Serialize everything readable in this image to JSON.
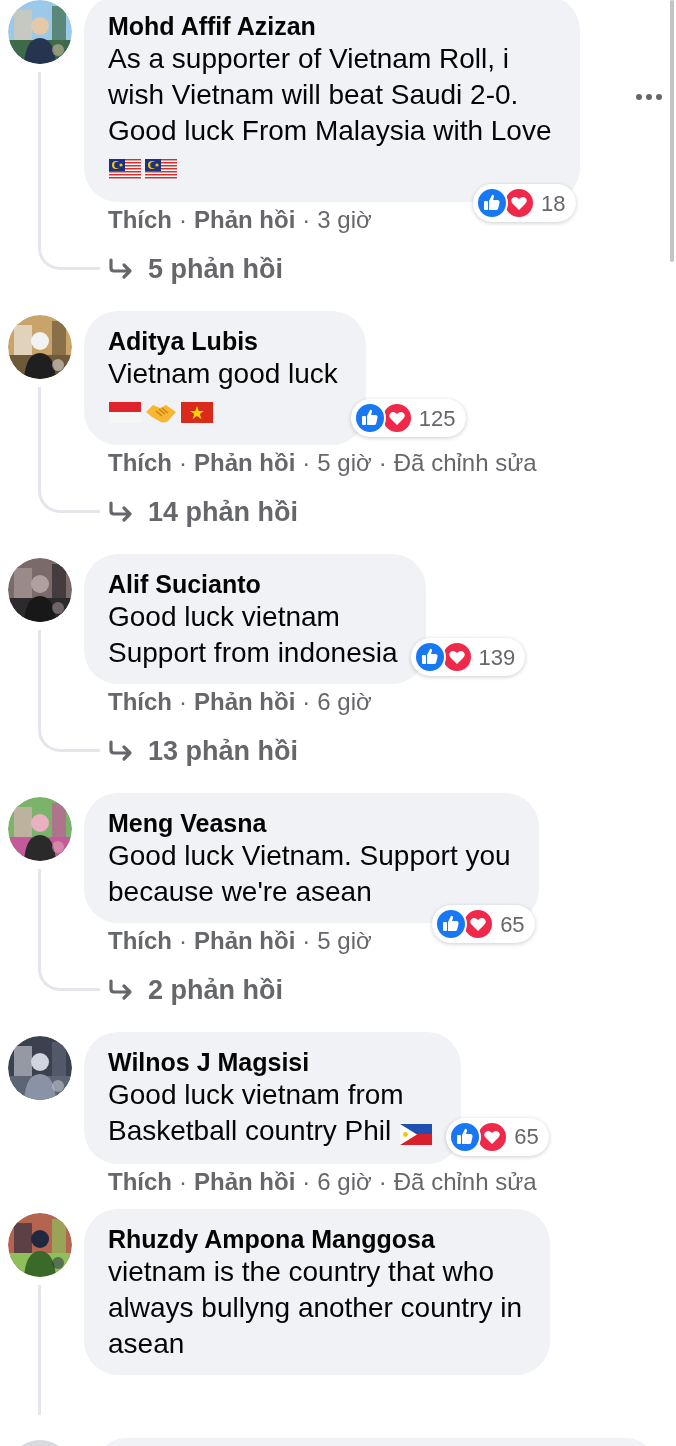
{
  "comments": [
    {
      "author": "Mohd Affif Azizan",
      "text": "As a supporter of Vietnam Roll, i\nwish Vietnam will beat Saudi 2-0.\nGood luck From Malaysia with Love",
      "emojis": [
        {
          "kind": "flag_malaysia"
        },
        {
          "kind": "flag_malaysia"
        }
      ],
      "reaction_count": "18",
      "meta": [
        {
          "kind": "link",
          "text": "Thích"
        },
        {
          "kind": "sep",
          "text": "·"
        },
        {
          "kind": "link",
          "text": "Phản hồi"
        },
        {
          "kind": "sep",
          "text": "·"
        },
        {
          "kind": "time",
          "text": "3 giờ"
        }
      ],
      "replies": "5 phản hồi",
      "thread": true,
      "more_menu": true
    },
    {
      "author": "Aditya Lubis",
      "text": "Vietnam good luck",
      "emojis": [
        {
          "kind": "flag_indonesia"
        },
        {
          "kind": "handshake"
        },
        {
          "kind": "flag_vietnam"
        }
      ],
      "reaction_count": "125",
      "meta": [
        {
          "kind": "link",
          "text": "Thích"
        },
        {
          "kind": "sep",
          "text": "·"
        },
        {
          "kind": "link",
          "text": "Phản hồi"
        },
        {
          "kind": "sep",
          "text": "·"
        },
        {
          "kind": "time",
          "text": "5 giờ"
        },
        {
          "kind": "sep",
          "text": "·"
        },
        {
          "kind": "edited",
          "text": "Đã chỉnh sửa"
        }
      ],
      "replies": "14 phản hồi",
      "thread": true,
      "more_menu": false
    },
    {
      "author": "Alif Sucianto",
      "text": "Good luck vietnam\nSupport from indonesia",
      "reaction_count": "139",
      "meta": [
        {
          "kind": "link",
          "text": "Thích"
        },
        {
          "kind": "sep",
          "text": "·"
        },
        {
          "kind": "link",
          "text": "Phản hồi"
        },
        {
          "kind": "sep",
          "text": "·"
        },
        {
          "kind": "time",
          "text": "6 giờ"
        }
      ],
      "replies": "13 phản hồi",
      "thread": true,
      "more_menu": false
    },
    {
      "author": "Meng Veasna",
      "text": "Good luck Vietnam. Support you\nbecause we're asean",
      "reaction_count": "65",
      "meta": [
        {
          "kind": "link",
          "text": "Thích"
        },
        {
          "kind": "sep",
          "text": "·"
        },
        {
          "kind": "link",
          "text": "Phản hồi"
        },
        {
          "kind": "sep",
          "text": "·"
        },
        {
          "kind": "time",
          "text": "5 giờ"
        }
      ],
      "replies": "2 phản hồi",
      "thread": true,
      "more_menu": false
    },
    {
      "author": "Wilnos J Magsisi",
      "text": "Good luck vietnam from\nBasketball country Phil",
      "inline_emoji": {
        "kind": "flag_philippines"
      },
      "reaction_count": "65",
      "meta": [
        {
          "kind": "link",
          "text": "Thích"
        },
        {
          "kind": "sep",
          "text": "·"
        },
        {
          "kind": "link",
          "text": "Phản hồi"
        },
        {
          "kind": "sep",
          "text": "·"
        },
        {
          "kind": "time",
          "text": "6 giờ"
        },
        {
          "kind": "sep",
          "text": "·"
        },
        {
          "kind": "edited",
          "text": "Đã chỉnh sửa"
        }
      ],
      "thread": false,
      "more_menu": false
    },
    {
      "author": "Rhuzdy Ampona Manggosa",
      "text": "vietnam is the country that who\nalways bullyng another country in\nasean",
      "thread": true,
      "more_menu": false
    }
  ]
}
